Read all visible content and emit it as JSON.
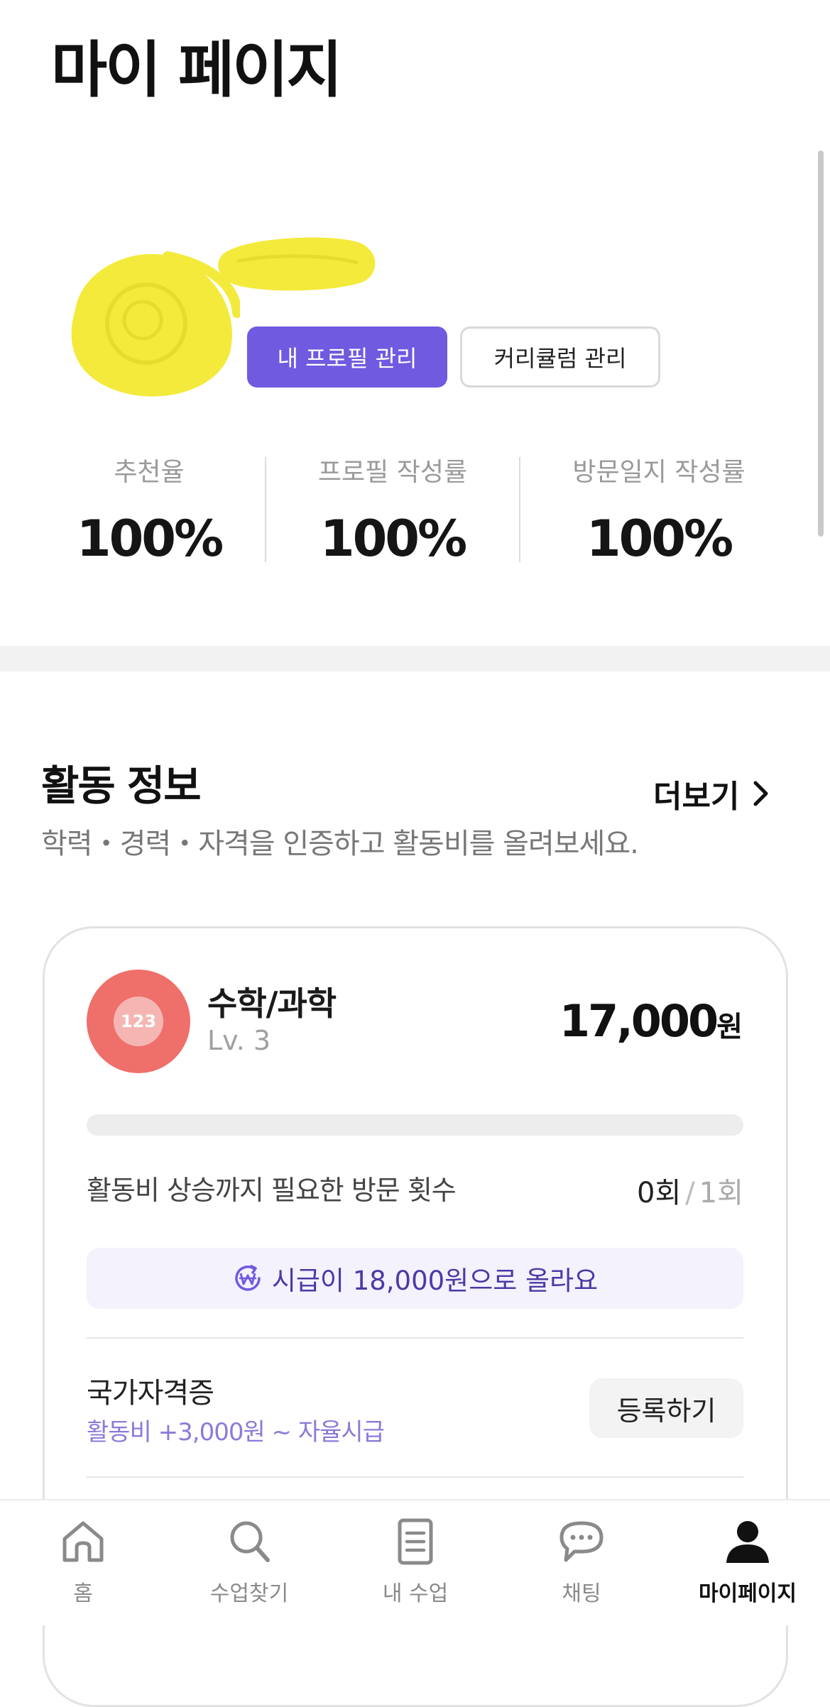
{
  "page_title": "마이 페이지",
  "profile": {
    "manage_profile_label": "내 프로필 관리",
    "manage_curriculum_label": "커리큘럼 관리"
  },
  "stats": [
    {
      "label": "추천율",
      "value": "100%"
    },
    {
      "label": "프로필 작성률",
      "value": "100%"
    },
    {
      "label": "방문일지 작성률",
      "value": "100%"
    }
  ],
  "activity": {
    "title": "활동 정보",
    "more_label": "더보기",
    "subtitle": "학력・경력・자격을 인증하고 활동비를 올려보세요.",
    "card": {
      "icon_text": "123",
      "subject": "수학/과학",
      "level": "Lv. 3",
      "price": "17,000",
      "price_unit": "원",
      "progress_fraction": 0,
      "visit_label": "활동비 상승까지 필요한 방문 횟수",
      "visit_current": "0회",
      "visit_separator": "/",
      "visit_total": "1회",
      "raise_message": "시급이 18,000원으로 올라요",
      "certificate": {
        "title": "국가자격증",
        "subtitle": "활동비 +3,000원 ~ 자율시급",
        "register_label": "등록하기"
      }
    }
  },
  "nav": {
    "items": [
      {
        "label": "홈",
        "icon": "home-icon"
      },
      {
        "label": "수업찾기",
        "icon": "search-icon"
      },
      {
        "label": "내 수업",
        "icon": "document-icon"
      },
      {
        "label": "채팅",
        "icon": "chat-icon"
      },
      {
        "label": "마이페이지",
        "icon": "person-icon"
      }
    ],
    "active_index": 4
  },
  "colors": {
    "accent": "#6f5ae0",
    "subject_icon": "#ef6f6a",
    "raise_text": "#4a3aa6",
    "certificate_sub": "#8b7bd9",
    "redaction": "#f3ea3c"
  }
}
